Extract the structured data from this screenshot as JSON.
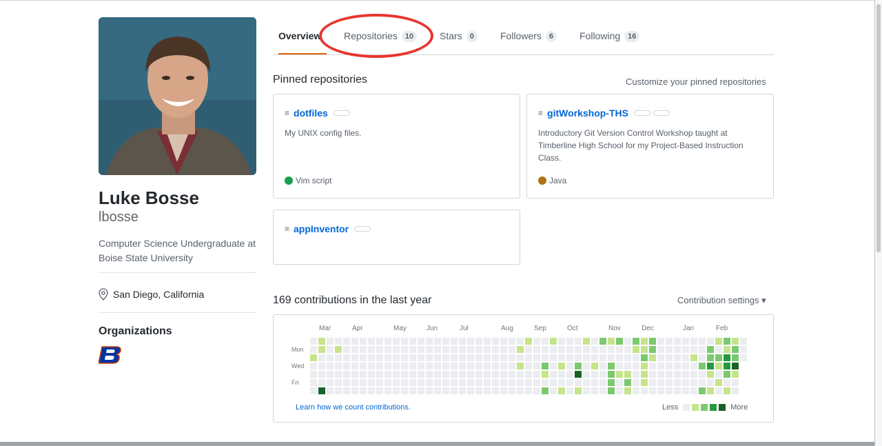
{
  "profile": {
    "full_name": "Luke Bosse",
    "username": "lbosse",
    "bio": "Computer Science Undergraduate at Boise State University",
    "location": "San Diego, California",
    "orgs_title": "Organizations"
  },
  "tabs": [
    {
      "label": "Overview",
      "count": "",
      "selected": true
    },
    {
      "label": "Repositories",
      "count": "10",
      "selected": false
    },
    {
      "label": "Stars",
      "count": "0",
      "selected": false
    },
    {
      "label": "Followers",
      "count": "6",
      "selected": false
    },
    {
      "label": "Following",
      "count": "16",
      "selected": false
    }
  ],
  "pinned": {
    "title": "Pinned repositories",
    "customize_link": "Customize your pinned repositories",
    "repos": [
      {
        "name": "dotfiles",
        "description": "My UNIX config files.",
        "language": "Vim script",
        "language_color": "#199f4b"
      },
      {
        "name": "gitWorkshop-THS",
        "description": "Introductory Git Version Control Workshop taught at Timberline High School for my Project-Based Instruction Class.",
        "language": "Java",
        "language_color": "#b07219"
      },
      {
        "name": "appInventor",
        "description": "",
        "language": "",
        "language_color": ""
      }
    ]
  },
  "contributions": {
    "title": "169 contributions in the last year",
    "settings_label": "Contribution settings ▾",
    "months": [
      "Mar",
      "Apr",
      "May",
      "Jun",
      "Jul",
      "Aug",
      "Sep",
      "Oct",
      "Nov",
      "Dec",
      "Jan",
      "Feb"
    ],
    "day_labels": [
      "Mon",
      "Wed",
      "Fri"
    ],
    "learn_link": "Learn how we count contributions.",
    "legend_less": "Less",
    "legend_more": "More",
    "colors": [
      "#ebedf0",
      "#c6e48b",
      "#7bc96f",
      "#239a3b",
      "#196127"
    ]
  }
}
